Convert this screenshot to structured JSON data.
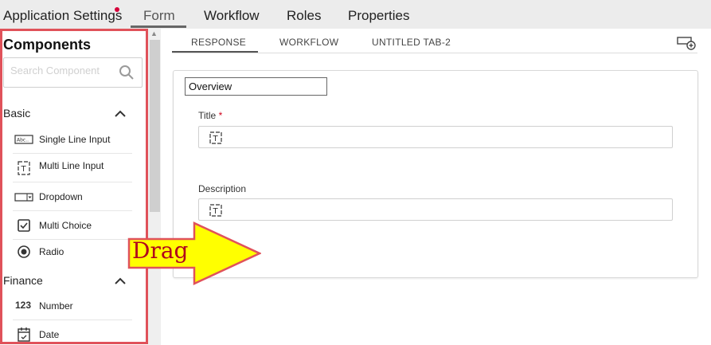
{
  "app": {
    "title": "Application Settings"
  },
  "top_tabs": [
    {
      "label": "Form",
      "active": true
    },
    {
      "label": "Workflow",
      "active": false
    },
    {
      "label": "Roles",
      "active": false
    },
    {
      "label": "Properties",
      "active": false
    }
  ],
  "palette": {
    "title": "Components",
    "search_placeholder": "Search Component",
    "sections": [
      {
        "name": "Basic",
        "items": [
          {
            "label": "Single Line Input",
            "icon": "single-line-input-icon"
          },
          {
            "label": "Multi Line Input",
            "icon": "multi-line-input-icon"
          },
          {
            "label": "Dropdown",
            "icon": "dropdown-icon"
          },
          {
            "label": "Multi Choice",
            "icon": "checkbox-icon"
          },
          {
            "label": "Radio",
            "icon": "radio-icon"
          }
        ]
      },
      {
        "name": "Finance",
        "items": [
          {
            "label": "Number",
            "icon_text": "123",
            "icon": "number-icon"
          },
          {
            "label": "Date",
            "icon": "calendar-icon"
          }
        ]
      }
    ]
  },
  "sub_tabs": [
    {
      "label": "RESPONSE",
      "active": true
    },
    {
      "label": "WORKFLOW",
      "active": false
    },
    {
      "label": "UNTITLED TAB-2",
      "active": false
    }
  ],
  "form": {
    "section_name": "Overview",
    "fields": [
      {
        "label": "Title",
        "required_mark": "*"
      },
      {
        "label": "Description"
      }
    ]
  },
  "annotation": {
    "text": "Drag",
    "color": "#ffff00",
    "outline": "#e0525a"
  },
  "colors": {
    "highlight_border": "#e0525a",
    "required": "#d0021b",
    "topbar_bg": "#ececec"
  }
}
